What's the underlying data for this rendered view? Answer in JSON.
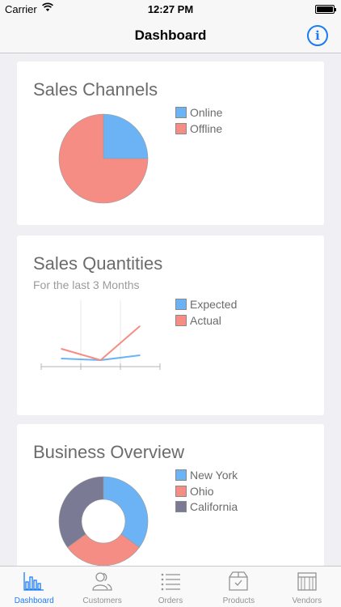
{
  "status_bar": {
    "carrier": "Carrier",
    "time": "12:27 PM"
  },
  "nav": {
    "title": "Dashboard",
    "info_icon": "info-icon",
    "info_glyph": "i"
  },
  "colors": {
    "blue": "#6cb3f5",
    "red": "#f58d85",
    "slate": "#7a7a94",
    "accent": "#1a7cf5"
  },
  "cards": {
    "sales_channels": {
      "title": "Sales Channels"
    },
    "sales_quantities": {
      "title": "Sales Quantities",
      "subtitle": "For the last 3 Months"
    },
    "business_overview": {
      "title": "Business Overview"
    }
  },
  "chart_data": [
    {
      "type": "pie",
      "title": "Sales Channels",
      "categories": [
        "Online",
        "Offline"
      ],
      "values": [
        25,
        75
      ],
      "colors": [
        "#6cb3f5",
        "#f58d85"
      ],
      "legend": [
        "Online",
        "Offline"
      ]
    },
    {
      "type": "line",
      "title": "Sales Quantities",
      "subtitle": "For the last 3 Months",
      "x": [
        1,
        2,
        3
      ],
      "series": [
        {
          "name": "Expected",
          "values": [
            2,
            1.5,
            3
          ],
          "color": "#6cb3f5"
        },
        {
          "name": "Actual",
          "values": [
            5,
            1.5,
            12
          ],
          "color": "#f58d85"
        }
      ],
      "ylim": [
        0,
        20
      ],
      "grid": true,
      "legend": [
        "Expected",
        "Actual"
      ]
    },
    {
      "type": "pie",
      "title": "Business Overview",
      "style": "donut",
      "categories": [
        "New York",
        "Ohio",
        "California"
      ],
      "values": [
        35,
        30,
        35
      ],
      "colors": [
        "#6cb3f5",
        "#f58d85",
        "#7a7a94"
      ],
      "legend": [
        "New York",
        "Ohio",
        "California"
      ]
    }
  ],
  "tabs": [
    {
      "label": "Dashboard",
      "icon": "bar-chart-icon",
      "active": true
    },
    {
      "label": "Customers",
      "icon": "customers-icon",
      "active": false
    },
    {
      "label": "Orders",
      "icon": "list-icon",
      "active": false
    },
    {
      "label": "Products",
      "icon": "box-icon",
      "active": false
    },
    {
      "label": "Vendors",
      "icon": "vendor-icon",
      "active": false
    }
  ]
}
